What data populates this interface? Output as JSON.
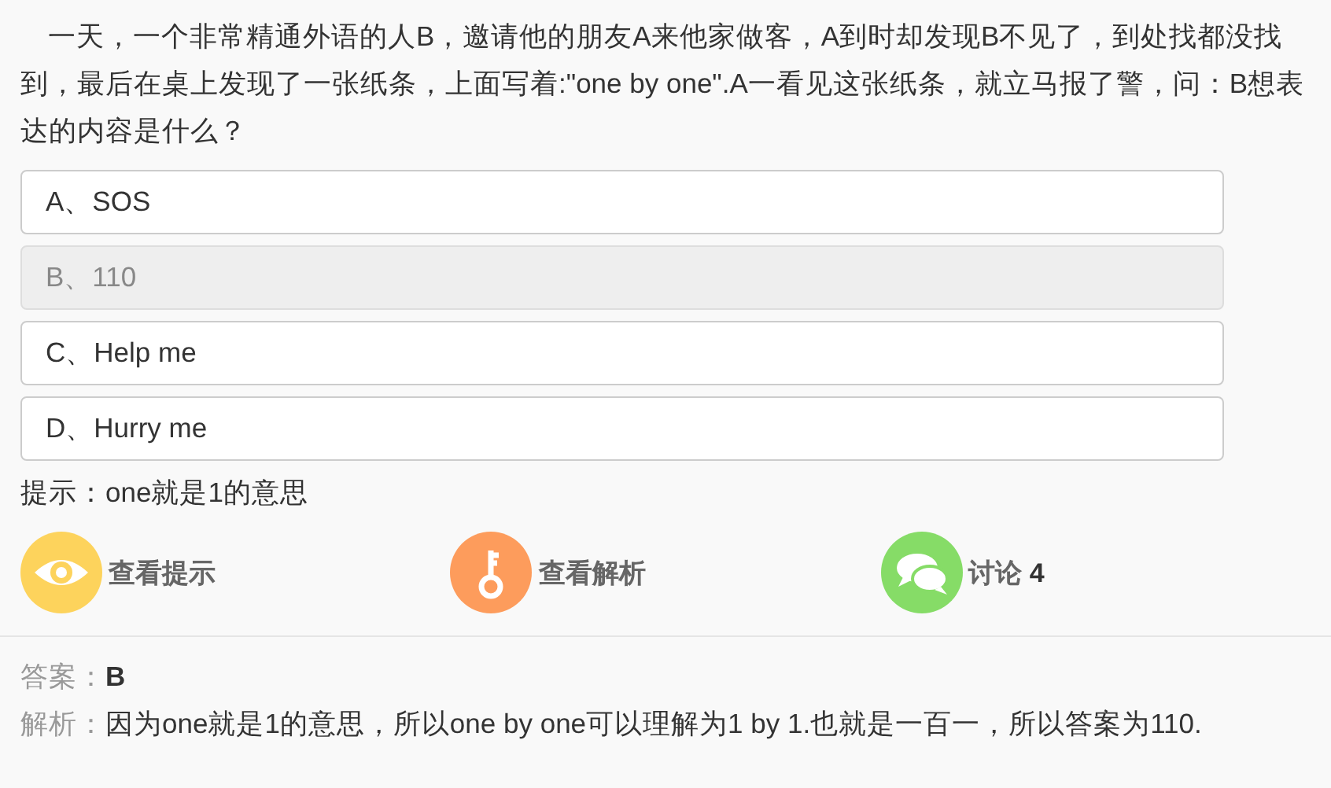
{
  "question": "一天，一个非常精通外语的人B，邀请他的朋友A来他家做客，A到时却发现B不见了，到处找都没找到，最后在桌上发现了一张纸条，上面写着:\"one by one\".A一看见这张纸条，就立马报了警，问：B想表达的内容是什么？",
  "options": [
    {
      "label": "A、SOS",
      "selected": false
    },
    {
      "label": "B、110",
      "selected": true
    },
    {
      "label": "C、Help me",
      "selected": false
    },
    {
      "label": "D、Hurry me",
      "selected": false
    }
  ],
  "hint": "提示：one就是1的意思",
  "actions": [
    {
      "kind": "hint",
      "label": "查看提示",
      "color": "#fdd35c"
    },
    {
      "kind": "analysis",
      "label": "查看解析",
      "color": "#fd9c5c"
    },
    {
      "kind": "discuss",
      "label": "讨论",
      "count": "4",
      "color": "#86dc67"
    }
  ],
  "answer": {
    "label": "答案：",
    "value": "B"
  },
  "analysis": {
    "label": "解析：",
    "value": "因为one就是1的意思，所以one by one可以理解为1 by 1.也就是一百一，所以答案为110."
  }
}
